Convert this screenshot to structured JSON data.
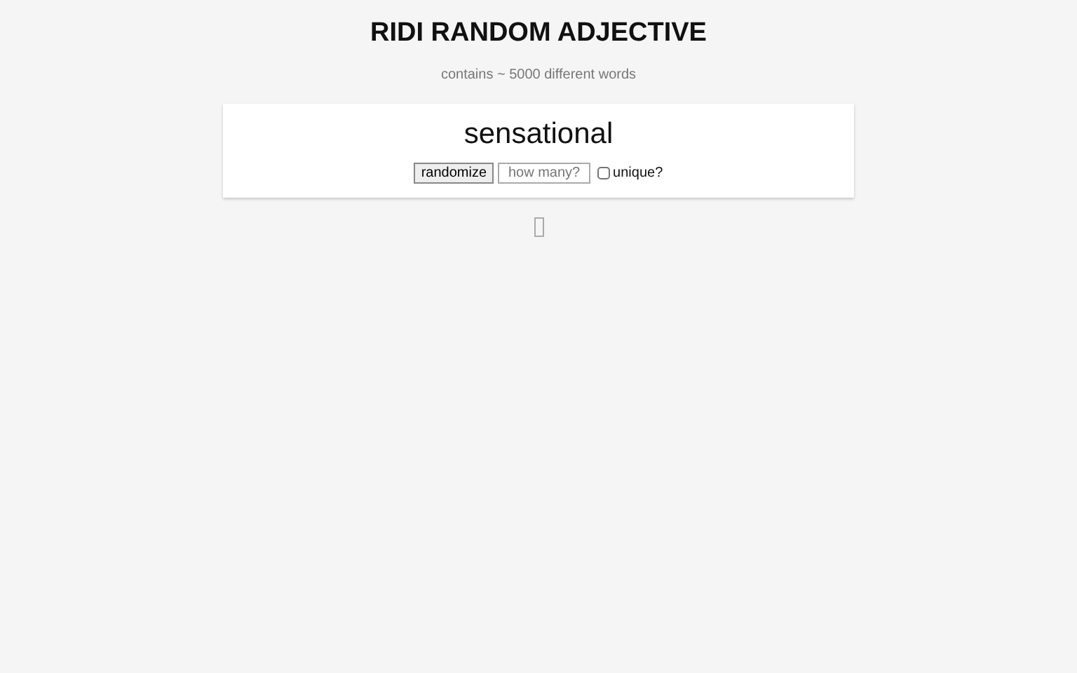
{
  "title": "RIDI RANDOM ADJECTIVE",
  "subtitle": "contains ~ 5000 different words",
  "word": "sensational",
  "controls": {
    "button": "randomize",
    "count_field": {
      "placeholder": "how many?"
    },
    "unique": {
      "label": "unique?",
      "checked": false
    }
  }
}
